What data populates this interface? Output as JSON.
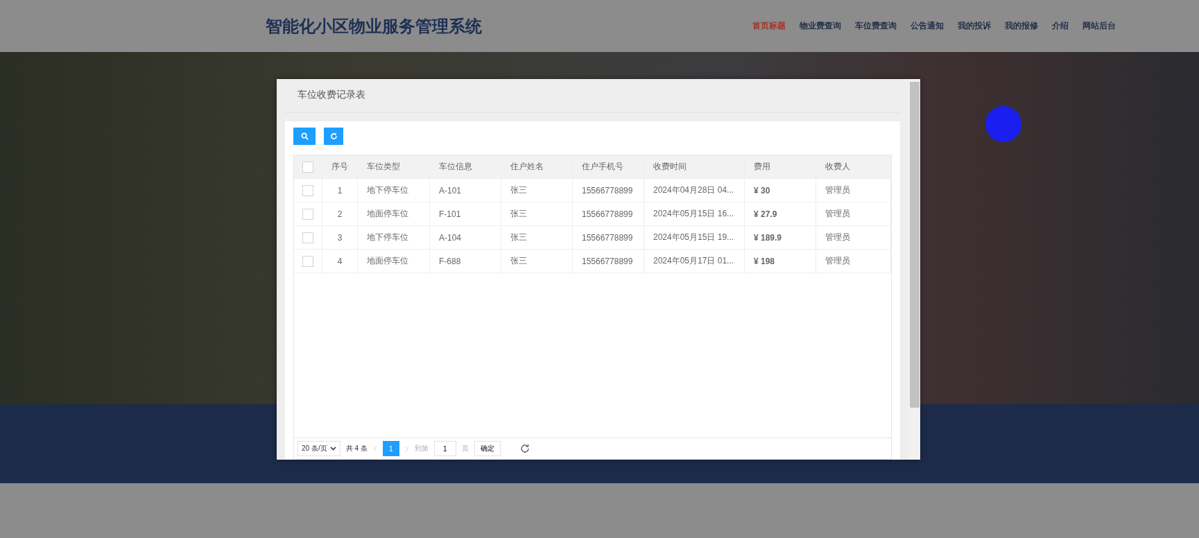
{
  "header": {
    "title": "智能化小区物业服务管理系统",
    "nav": [
      {
        "label": "首页标题",
        "selected": true
      },
      {
        "label": "物业费查询",
        "selected": false
      },
      {
        "label": "车位费查询",
        "selected": false
      },
      {
        "label": "公告通知",
        "selected": false
      },
      {
        "label": "我的投诉",
        "selected": false
      },
      {
        "label": "我的报修",
        "selected": false
      },
      {
        "label": "介绍",
        "selected": false
      },
      {
        "label": "网站后台",
        "selected": false
      }
    ]
  },
  "modal": {
    "title": "车位收费记录表",
    "table": {
      "select_all_checked": false,
      "columns": [
        "序号",
        "车位类型",
        "车位信息",
        "住户姓名",
        "住户手机号",
        "收费时间",
        "费用",
        "收费人"
      ],
      "rows": [
        {
          "checked": false,
          "cells": [
            "1",
            "地下停车位",
            "A-101",
            "张三",
            "15566778899",
            "2024年04月28日 04...",
            "¥ 30",
            "管理员"
          ]
        },
        {
          "checked": false,
          "cells": [
            "2",
            "地面停车位",
            "F-101",
            "张三",
            "15566778899",
            "2024年05月15日 16...",
            "¥ 27.9",
            "管理员"
          ]
        },
        {
          "checked": false,
          "cells": [
            "3",
            "地下停车位",
            "A-104",
            "张三",
            "15566778899",
            "2024年05月15日 19...",
            "¥ 189.9",
            "管理员"
          ]
        },
        {
          "checked": false,
          "cells": [
            "4",
            "地面停车位",
            "F-688",
            "张三",
            "15566778899",
            "2024年05月17日 01...",
            "¥ 198",
            "管理员"
          ]
        }
      ]
    },
    "pagination": {
      "page_size": "20 条/页",
      "total": "共 4 条",
      "pages": [
        {
          "label": "1",
          "selected": true
        }
      ],
      "goto_label": "到第",
      "goto_value": "1",
      "page_unit": "页",
      "confirm": "确定"
    }
  }
}
